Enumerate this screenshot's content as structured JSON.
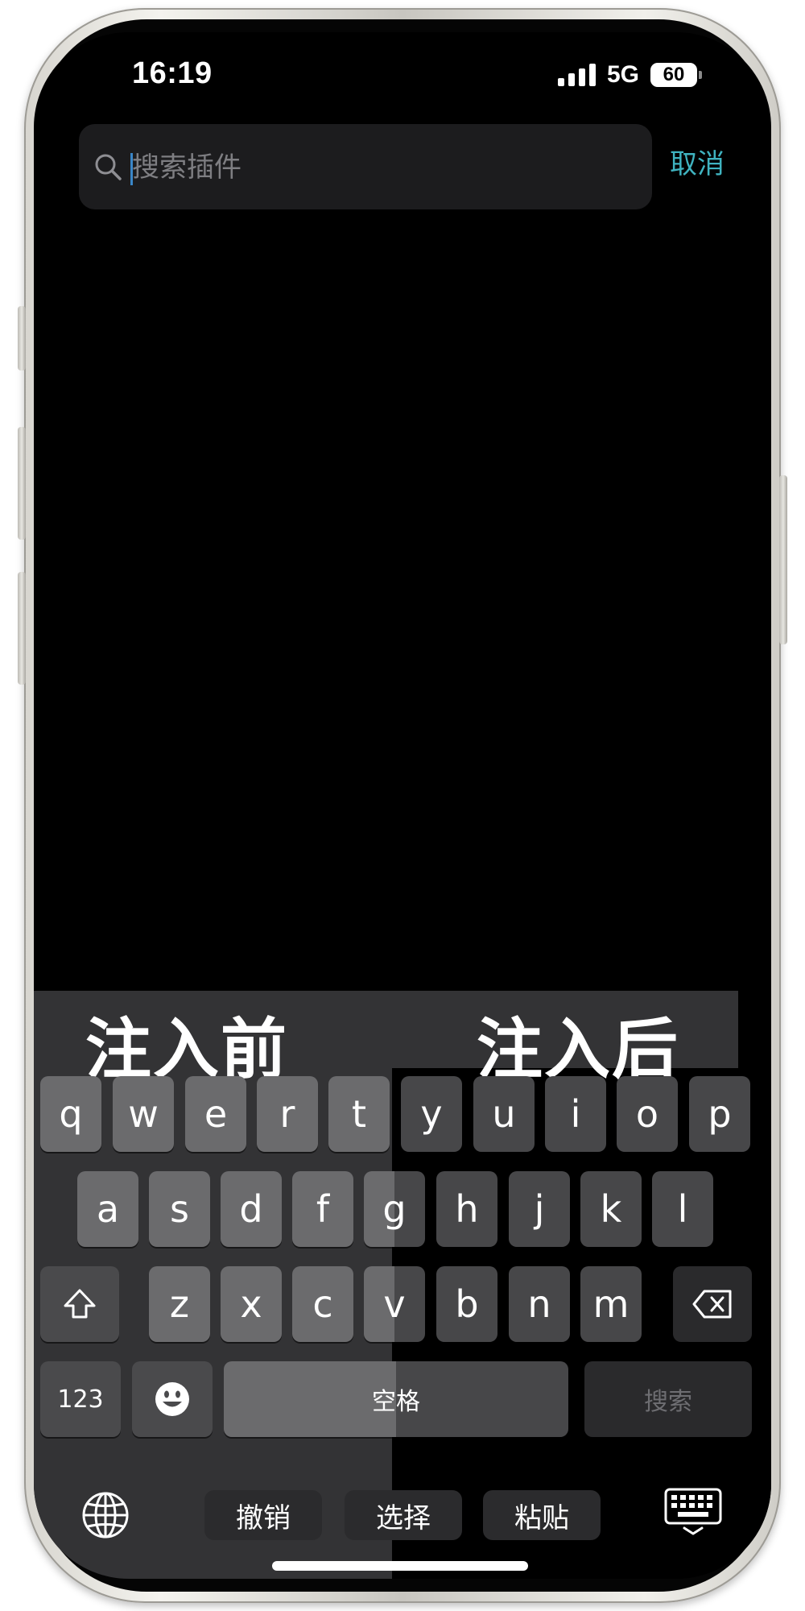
{
  "status_bar": {
    "time": "16:19",
    "network": "5G",
    "battery": "60"
  },
  "search": {
    "placeholder": "搜索插件",
    "value": "",
    "cancel_label": "取消"
  },
  "comparison_labels": {
    "before": "注入前",
    "after": "注入后"
  },
  "keyboard": {
    "row1": [
      "q",
      "w",
      "e",
      "r",
      "t",
      "y",
      "u",
      "i",
      "o",
      "p"
    ],
    "row2": [
      "a",
      "s",
      "d",
      "f",
      "g",
      "h",
      "j",
      "k",
      "l"
    ],
    "row3": [
      "z",
      "x",
      "c",
      "v",
      "b",
      "n",
      "m"
    ],
    "numbers_key": "123",
    "space_label": "空格",
    "search_key": "搜索"
  },
  "edit_bar": {
    "undo": "撤销",
    "select": "选择",
    "paste": "粘贴"
  },
  "icons": [
    "search-icon",
    "shift-icon",
    "delete-icon",
    "emoji-icon",
    "globe-icon",
    "keyboard-dismiss-icon"
  ],
  "colors": {
    "accent": "#3fb3c0",
    "screen_bg": "#000000",
    "key_before": "#6b6b6d",
    "key_after": "#474749"
  }
}
